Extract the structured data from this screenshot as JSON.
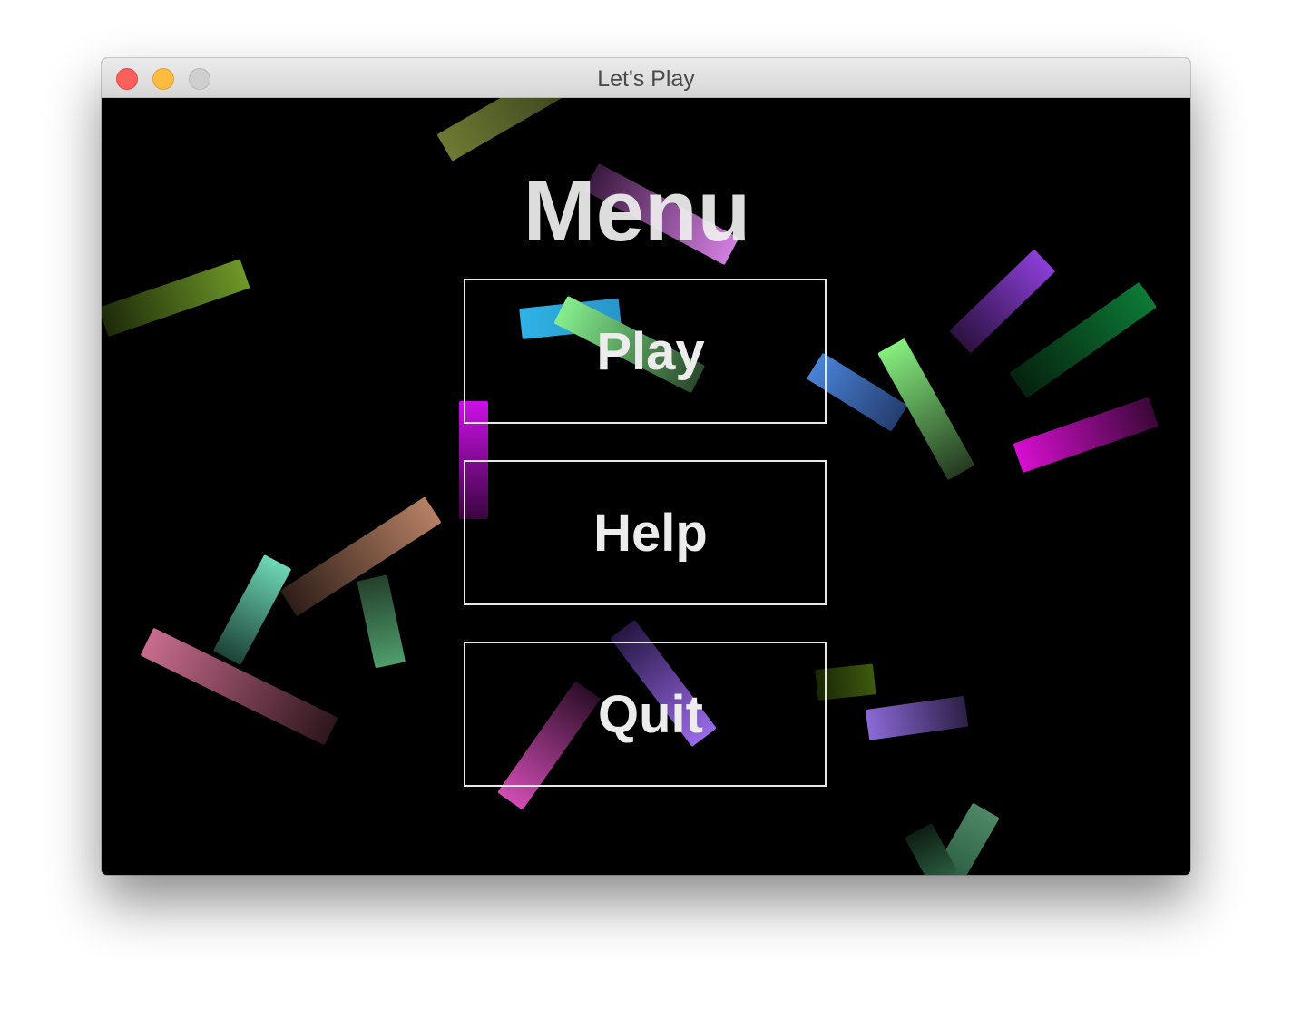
{
  "window": {
    "title": "Let's Play"
  },
  "menu": {
    "title": "Menu",
    "buttons": [
      {
        "label": "Play"
      },
      {
        "label": "Help"
      },
      {
        "label": "Quit"
      }
    ]
  },
  "background": {
    "color": "#000000",
    "decoration": "falling-colored-sticks"
  },
  "colors": {
    "button_border": "#e8e8e8",
    "text": "#ececec",
    "close_button": "#fc605c",
    "minimize_button": "#fdbc40",
    "zoom_button": "#cfcfcf"
  }
}
